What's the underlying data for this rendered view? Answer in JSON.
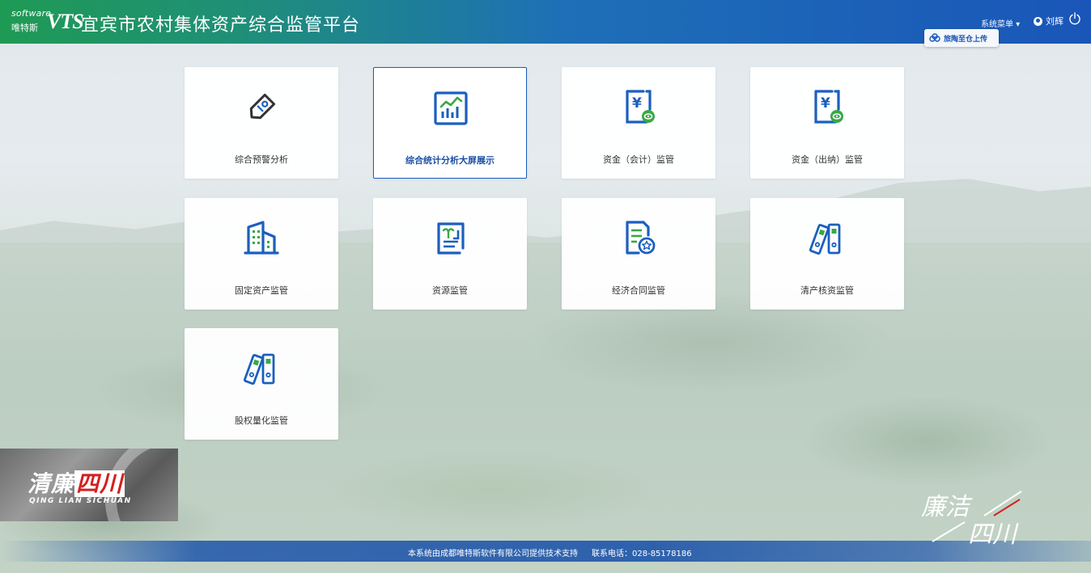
{
  "header": {
    "logo_software": "software",
    "logo_cn": "唯特斯",
    "logo_mark": "VTS",
    "title": "宜宾市农村集体资产综合监管平台",
    "system_menu": "系统菜单 ▾",
    "user_name": "刘辉",
    "upload_label": "旅陶至仓上传"
  },
  "tiles": [
    {
      "label": "综合预警分析",
      "icon": "tag-icon"
    },
    {
      "label": "综合统计分析大屏展示",
      "icon": "bar-chart-icon"
    },
    {
      "label": "资金（会计）监管",
      "icon": "yuan-ledger-icon"
    },
    {
      "label": "资金（出纳）监管",
      "icon": "yuan-ledger-icon"
    },
    {
      "label": "固定资产监管",
      "icon": "building-icon"
    },
    {
      "label": "资源监管",
      "icon": "resource-document-icon"
    },
    {
      "label": "经济合同监管",
      "icon": "contract-star-icon"
    },
    {
      "label": "清产核资监管",
      "icon": "binder-icon"
    },
    {
      "label": "股权量化监管",
      "icon": "binder-icon"
    }
  ],
  "footer": {
    "support_text": "本系统由成都唯特斯软件有限公司提供技术支持",
    "phone_text": "联系电话：028-85178186"
  },
  "watermark": {
    "left_cn_white": "清廉",
    "left_cn_red": "四川",
    "left_pinyin": "QING LIAN SICHUAN",
    "right_line1": "廉洁",
    "right_line2": "四川"
  },
  "colors": {
    "header_green": "#1f9a54",
    "header_blue": "#1a56b8",
    "icon_blue": "#1b5fbf",
    "icon_green": "#3aa845",
    "footer_blue": "#1e55aa"
  }
}
